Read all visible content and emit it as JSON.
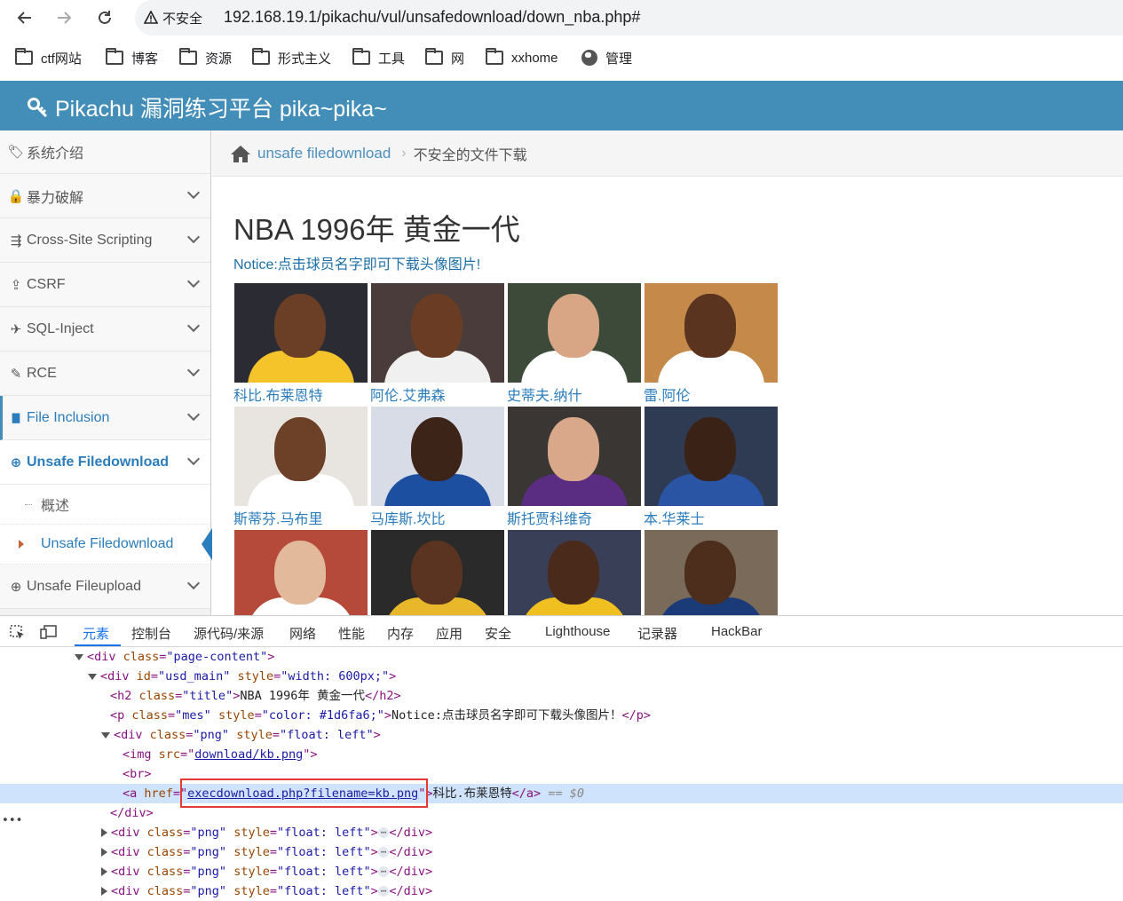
{
  "browser": {
    "security_label": "不安全",
    "url": "192.168.19.1/pikachu/vul/unsafedownload/down_nba.php#",
    "bookmarks": [
      "ctf网站",
      "博客",
      "资源",
      "形式主义",
      "工具",
      "网",
      "xxhome",
      "管理"
    ]
  },
  "app": {
    "title": "Pikachu 漏洞练习平台 pika~pika~",
    "header_color": "#438eb9"
  },
  "sidebar": {
    "items": [
      {
        "label": "系统介绍",
        "icon": "tags-icon",
        "glyph": "🏷"
      },
      {
        "label": "暴力破解",
        "icon": "lock-icon",
        "glyph": "🔒"
      },
      {
        "label": "Cross-Site Scripting",
        "icon": "indent-icon",
        "glyph": "⇶"
      },
      {
        "label": "CSRF",
        "icon": "share-icon",
        "glyph": "⇪"
      },
      {
        "label": "SQL-Inject",
        "icon": "plane-icon",
        "glyph": "✈"
      },
      {
        "label": "RCE",
        "icon": "pencil-icon",
        "glyph": "✎"
      },
      {
        "label": "File Inclusion",
        "icon": "file-icon",
        "glyph": "▇"
      },
      {
        "label": "Unsafe Filedownload",
        "icon": "download-icon",
        "glyph": "⊕"
      },
      {
        "label": "Unsafe Fileupload",
        "icon": "upload-icon",
        "glyph": "⊕"
      }
    ],
    "subitems": [
      {
        "label": "概述"
      },
      {
        "label": "Unsafe Filedownload"
      }
    ]
  },
  "breadcrumb": {
    "link": "unsafe filedownload",
    "separator": "›",
    "current": "不安全的文件下载"
  },
  "main": {
    "title": "NBA 1996年 黄金一代",
    "notice": "Notice:点击球员名字即可下载头像图片!",
    "notice_color": "#1d6fa6",
    "players": [
      {
        "name": "科比.布莱恩特",
        "bg": "#2b2b33",
        "skin": "#6b3f26",
        "jersey": "#f5c32a"
      },
      {
        "name": "阿伦.艾弗森",
        "bg": "#4a3c3a",
        "skin": "#6a3c24",
        "jersey": "#f0f0f0"
      },
      {
        "name": "史蒂夫.纳什",
        "bg": "#3d4a3a",
        "skin": "#d8a685",
        "jersey": "#ffffff"
      },
      {
        "name": "雷.阿伦",
        "bg": "#c58a4a",
        "skin": "#5b3420",
        "jersey": "#ffffff"
      },
      {
        "name": "斯蒂芬.马布里",
        "bg": "#e8e4e0",
        "skin": "#6d4128",
        "jersey": "#ffffff"
      },
      {
        "name": "马库斯.坎比",
        "bg": "#d8dce6",
        "skin": "#3c2418",
        "jersey": "#1d4fa0"
      },
      {
        "name": "斯托贾科维奇",
        "bg": "#3a3634",
        "skin": "#d9a88a",
        "jersey": "#5a2d82"
      },
      {
        "name": "本.华莱士",
        "bg": "#2f3b52",
        "skin": "#3a2216",
        "jersey": "#2a54a4"
      },
      {
        "name": "",
        "bg": "#b64a3a",
        "skin": "#e2b99a",
        "jersey": "#ffffff"
      },
      {
        "name": "",
        "bg": "#2a2a2a",
        "skin": "#5a3420",
        "jersey": "#e8b82a"
      },
      {
        "name": "",
        "bg": "#3a3f58",
        "skin": "#4a2a1a",
        "jersey": "#f0c020"
      },
      {
        "name": "",
        "bg": "#7a6a5a",
        "skin": "#4d2d1c",
        "jersey": "#1a3a78"
      }
    ]
  },
  "devtools": {
    "tabs": [
      "元素",
      "控制台",
      "源代码/来源",
      "网络",
      "性能",
      "内存",
      "应用",
      "安全",
      "Lighthouse",
      "记录器",
      "HackBar"
    ],
    "active_tab": "元素",
    "lines": {
      "l1_tag": "<div ",
      "l1_attr": "class",
      "l1_val": "\"page-content\"",
      "l1_end": ">",
      "l2_tag": "<div ",
      "l2_a1": "id",
      "l2_v1": "\"usd_main\"",
      "l2_a2": " style",
      "l2_v2": "\"width: 600px;\"",
      "l2_end": ">",
      "l3_tag": "<h2 ",
      "l3_attr": "class",
      "l3_val": "\"title\"",
      "l3_text": "NBA 1996年 黄金一代",
      "l3_close": "</h2>",
      "l4_tag": "<p ",
      "l4_a1": "class",
      "l4_v1": "\"mes\"",
      "l4_a2": " style",
      "l4_v2": "\"color: #1d6fa6;\"",
      "l4_text": "Notice:点击球员名字即可下载头像图片！",
      "l4_close": "</p>",
      "l5_tag": "<div ",
      "l5_a1": "class",
      "l5_v1": "\"png\"",
      "l5_a2": " style",
      "l5_v2": "\"float: left\"",
      "l5_end": ">",
      "l6_tag": "<img ",
      "l6_attr": "src",
      "l6_link": "download/kb.png",
      "l6_end": ">",
      "l7": "<br>",
      "l8_tag": "<a ",
      "l8_attr": "href",
      "l8_link": "execdownload.php?filename=kb.png",
      "l8_text": "科比.布莱恩特",
      "l8_close": "</a>",
      "l8_ref": " == $0",
      "l9": "</div>",
      "collapsed_tag": "<div ",
      "collapsed_a1": "class",
      "collapsed_v1": "\"png\"",
      "collapsed_a2": " style",
      "collapsed_v2": "\"float: left\"",
      "collapsed_ell": "⋯",
      "collapsed_close": "</div>"
    }
  }
}
